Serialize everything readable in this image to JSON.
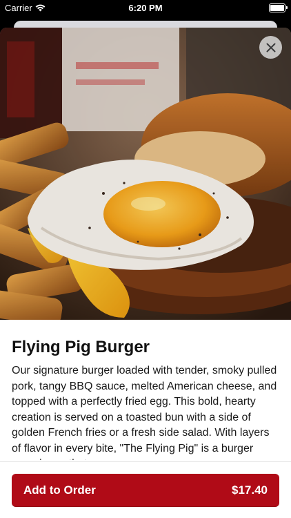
{
  "status_bar": {
    "carrier": "Carrier",
    "time": "6:20 PM"
  },
  "item": {
    "title": "Flying Pig Burger",
    "description": "Our signature burger loaded with tender, smoky pulled pork, tangy BBQ sauce, melted American cheese, and topped with a perfectly fried egg. This bold, hearty creation is served on a toasted bun with a side of golden French fries or a fresh side salad. With layers of flavor in every bite, \"The Flying Pig\" is a burger experience that soars"
  },
  "order": {
    "label": "Add to Order",
    "price": "$17.40"
  },
  "colors": {
    "accent": "#b00b17"
  },
  "icons": {
    "close": "close-icon",
    "wifi": "wifi-icon",
    "battery": "battery-icon"
  }
}
